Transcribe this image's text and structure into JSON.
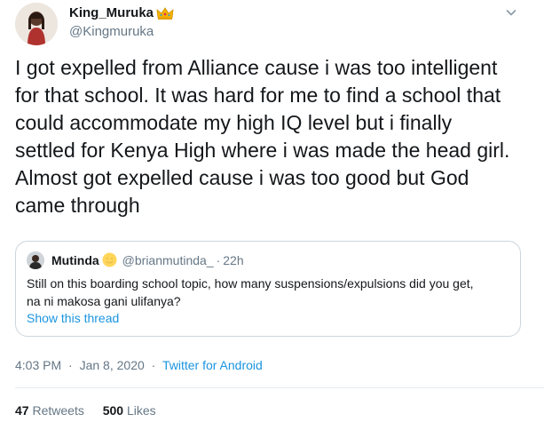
{
  "tweet": {
    "display_name": "King_Muruka",
    "handle": "@Kingmuruka",
    "text": "I got expelled from Alliance cause i was too intelligent\nfor that school. It was hard for me to find a school that\ncould accommodate my high IQ level but i finally\nsettled for Kenya High where i was made the head girl.\nAlmost got expelled cause i was too good but God\ncame through",
    "menu_icon": "chevron-down-icon",
    "badge_icon": "crown-emoji-icon"
  },
  "quote": {
    "name": "Mutinda",
    "emoji_icon": "smiley-emoji-icon",
    "handle": "@brianmutinda_",
    "separator": "·",
    "time": "22h",
    "text": "Still on this boarding school topic, how many suspensions/expulsions did you get,\nna ni makosa gani ulifanya?",
    "show_thread": "Show this thread"
  },
  "meta": {
    "time": "4:03 PM",
    "separator": "·",
    "date": "Jan 8, 2020",
    "source": "Twitter for Android"
  },
  "stats": {
    "retweets_count": "47",
    "retweets_label": "Retweets",
    "likes_count": "500",
    "likes_label": "Likes"
  },
  "colors": {
    "link": "#1b95e0",
    "secondary_text": "#657786",
    "border": "#ccd6dd"
  }
}
